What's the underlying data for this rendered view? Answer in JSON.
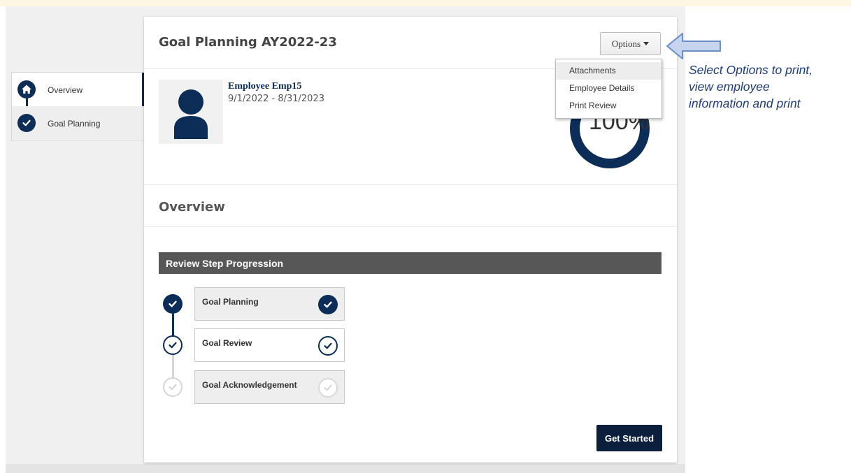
{
  "card": {
    "title": "Goal Planning AY2022-23",
    "options_label": "Options"
  },
  "sidebar": {
    "items": [
      {
        "label": "Overview",
        "icon": "home-icon",
        "active": true
      },
      {
        "label": "Goal Planning",
        "icon": "check-icon",
        "active": false
      }
    ]
  },
  "employee": {
    "name": "Employee Emp15",
    "dates": "9/1/2022 - 8/31/2023"
  },
  "progress": {
    "value_text": "100%",
    "fraction": 1.0
  },
  "options_menu": {
    "items": [
      "Attachments",
      "Employee Details",
      "Print Review"
    ],
    "highlighted": "Attachments"
  },
  "overview": {
    "title": "Overview",
    "section_title": "Review Step Progression",
    "steps": [
      {
        "label": "Goal Planning",
        "status": "complete"
      },
      {
        "label": "Goal Review",
        "status": "current"
      },
      {
        "label": "Goal Acknowledgement",
        "status": "pending"
      }
    ],
    "button_label": "Get Started"
  },
  "callout": {
    "lines": [
      "Select Options to print,",
      "view employee",
      "information and print"
    ]
  },
  "colors": {
    "navy": "#0c2d57",
    "dark_button": "#0b1e3b",
    "section_bar": "#575757",
    "callout_text": "#1f3d7a",
    "arrow_fill": "#c6d4ee",
    "arrow_stroke": "#6a8fc9"
  }
}
